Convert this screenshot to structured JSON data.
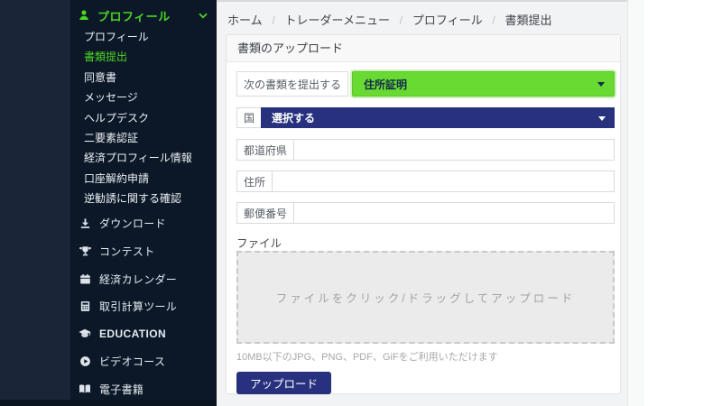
{
  "sidebar": {
    "header": {
      "label": "プロフィール",
      "icon": "person-icon",
      "chevron": "chevron-down-icon"
    },
    "submenu": [
      {
        "label": "プロフィール",
        "active": false
      },
      {
        "label": "書類提出",
        "active": true
      },
      {
        "label": "同意書",
        "active": false
      },
      {
        "label": "メッセージ",
        "active": false
      },
      {
        "label": "ヘルプデスク",
        "active": false
      },
      {
        "label": "二要素認証",
        "active": false
      },
      {
        "label": "経済プロフィール情報",
        "active": false
      },
      {
        "label": "口座解約申請",
        "active": false
      },
      {
        "label": "逆勧誘に関する確認",
        "active": false
      }
    ],
    "menu_items": [
      {
        "icon": "download-icon",
        "label": "ダウンロード"
      },
      {
        "icon": "trophy-icon",
        "label": "コンテスト"
      },
      {
        "icon": "calendar-icon",
        "label": "経済カレンダー"
      },
      {
        "icon": "calculator-icon",
        "label": "取引計算ツール"
      },
      {
        "icon": "graduation-cap-icon",
        "label": "EDUCATION"
      },
      {
        "icon": "play-circle-icon",
        "label": "ビデオコース"
      },
      {
        "icon": "book-icon",
        "label": "電子書籍"
      }
    ]
  },
  "breadcrumb": {
    "separator": "/",
    "items": [
      "ホーム",
      "トレーダーメニュー",
      "プロフィール",
      "書類提出"
    ]
  },
  "card": {
    "title": "書類のアップロード",
    "document_type": {
      "label": "次の書類を提出する",
      "value": "住所証明"
    },
    "country": {
      "label": "国",
      "value": "選択する"
    },
    "fields": [
      {
        "label": "都道府県",
        "value": ""
      },
      {
        "label": "住所",
        "value": ""
      },
      {
        "label": "郵便番号",
        "value": ""
      }
    ],
    "file": {
      "label": "ファイル",
      "dropzone_text": "ファイルをクリック/ドラッグしてアップロード",
      "helper": "10MB以下のJPG、PNG、PDF、GiFをご利用いただけます"
    },
    "upload_button": "アップロード"
  },
  "colors": {
    "accent_green": "#4ad621",
    "select_green_bg": "#68da32",
    "navy_button": "#27317e",
    "sidebar_menu_bg": "#0c1828",
    "sidebar_rail_bg": "#1a2538",
    "page_bg": "#f2f3f4"
  }
}
